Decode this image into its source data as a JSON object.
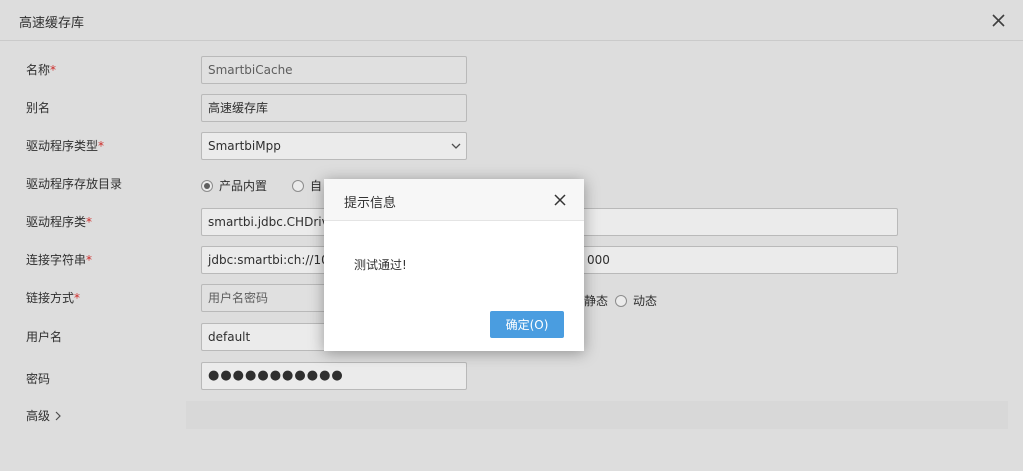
{
  "window": {
    "title": "高速缓存库"
  },
  "form": {
    "name": {
      "label": "名称",
      "required_mark": "*",
      "value": "SmartbiCache"
    },
    "alias": {
      "label": "别名",
      "value": "高速缓存库"
    },
    "driver_type": {
      "label": "驱动程序类型",
      "required_mark": "*",
      "value": "SmartbiMpp"
    },
    "driver_dir": {
      "label": "驱动程序存放目录",
      "options": [
        "产品内置",
        "自"
      ],
      "selected": "产品内置"
    },
    "driver_class": {
      "label": "驱动程序类",
      "required_mark": "*",
      "value": "smartbi.jdbc.CHDrive"
    },
    "conn_string": {
      "label": "连接字符串",
      "required_mark": "*",
      "value_left": "jdbc:smartbi:ch://10.",
      "value_right": "000"
    },
    "link_mode": {
      "label": "链接方式",
      "required_mark": "*",
      "value": "用户名密码",
      "options": [
        "静态",
        "动态"
      ]
    },
    "username": {
      "label": "用户名",
      "value": "default"
    },
    "password": {
      "label": "密码",
      "value": "●●●●●●●●●●●"
    },
    "advanced": {
      "label": "高级"
    }
  },
  "dialog": {
    "title": "提示信息",
    "message": "测试通过!",
    "ok_label": "确定(O)"
  },
  "colors": {
    "accent": "#4a9de0",
    "required": "#e0312e"
  }
}
